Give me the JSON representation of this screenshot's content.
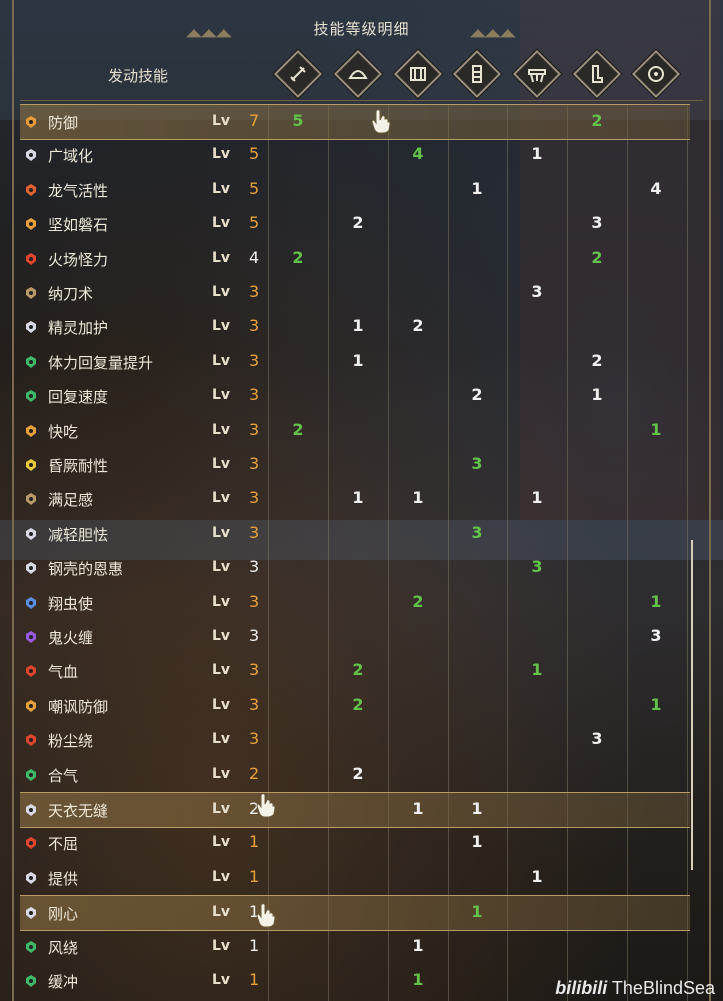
{
  "header": {
    "title": "技能等级明细",
    "active_skills_label": "发动技能"
  },
  "equipment_icons": [
    {
      "name": "weapon-icon"
    },
    {
      "name": "helmet-icon"
    },
    {
      "name": "chest-armor-icon"
    },
    {
      "name": "gauntlet-icon"
    },
    {
      "name": "waist-armor-icon"
    },
    {
      "name": "greaves-icon"
    },
    {
      "name": "talisman-icon"
    }
  ],
  "skills": [
    {
      "name": "防御",
      "lv_label": "Lv",
      "level": "7",
      "level_color": "o",
      "highlight": true,
      "icon_color": "#e89a3a",
      "cells": [
        [
          "5",
          "g"
        ],
        null,
        null,
        null,
        null,
        [
          "2",
          "g"
        ],
        null
      ]
    },
    {
      "name": "广域化",
      "lv_label": "Lv",
      "level": "5",
      "level_color": "o",
      "icon_color": "#d9d9e6",
      "cells": [
        null,
        null,
        [
          "4",
          "g"
        ],
        null,
        [
          "1",
          "w"
        ],
        null,
        null
      ]
    },
    {
      "name": "龙气活性",
      "lv_label": "Lv",
      "level": "5",
      "level_color": "o",
      "icon_color": "#e0622e",
      "cells": [
        null,
        null,
        null,
        [
          "1",
          "w"
        ],
        null,
        null,
        [
          "4",
          "w"
        ]
      ]
    },
    {
      "name": "坚如磐石",
      "lv_label": "Lv",
      "level": "5",
      "level_color": "o",
      "icon_color": "#e8a13a",
      "cells": [
        null,
        [
          "2",
          "w"
        ],
        null,
        null,
        null,
        [
          "3",
          "w"
        ],
        null
      ]
    },
    {
      "name": "火场怪力",
      "lv_label": "Lv",
      "level": "4",
      "level_color": "w",
      "icon_color": "#e0452e",
      "cells": [
        [
          "2",
          "g"
        ],
        null,
        null,
        null,
        null,
        [
          "2",
          "g"
        ],
        null
      ]
    },
    {
      "name": "纳刀术",
      "lv_label": "Lv",
      "level": "3",
      "level_color": "o",
      "icon_color": "#b89a6a",
      "cells": [
        null,
        null,
        null,
        null,
        [
          "3",
          "w"
        ],
        null,
        null
      ]
    },
    {
      "name": "精灵加护",
      "lv_label": "Lv",
      "level": "3",
      "level_color": "o",
      "icon_color": "#d9d9e6",
      "cells": [
        null,
        [
          "1",
          "w"
        ],
        [
          "2",
          "w"
        ],
        null,
        null,
        null,
        null
      ]
    },
    {
      "name": "体力回复量提升",
      "lv_label": "Lv",
      "level": "3",
      "level_color": "o",
      "icon_color": "#3fb86a",
      "cells": [
        null,
        [
          "1",
          "w"
        ],
        null,
        null,
        null,
        [
          "2",
          "w"
        ],
        null
      ]
    },
    {
      "name": "回复速度",
      "lv_label": "Lv",
      "level": "3",
      "level_color": "o",
      "icon_color": "#3fb86a",
      "cells": [
        null,
        null,
        null,
        [
          "2",
          "w"
        ],
        null,
        [
          "1",
          "w"
        ],
        null
      ]
    },
    {
      "name": "快吃",
      "lv_label": "Lv",
      "level": "3",
      "level_color": "o",
      "icon_color": "#e8a13a",
      "cells": [
        [
          "2",
          "g"
        ],
        null,
        null,
        null,
        null,
        null,
        [
          "1",
          "g"
        ]
      ]
    },
    {
      "name": "昏厥耐性",
      "lv_label": "Lv",
      "level": "3",
      "level_color": "o",
      "icon_color": "#e8c93a",
      "cells": [
        null,
        null,
        null,
        [
          "3",
          "g"
        ],
        null,
        null,
        null
      ]
    },
    {
      "name": "满足感",
      "lv_label": "Lv",
      "level": "3",
      "level_color": "o",
      "icon_color": "#b89a6a",
      "cells": [
        null,
        [
          "1",
          "w"
        ],
        [
          "1",
          "w"
        ],
        null,
        [
          "1",
          "w"
        ],
        null,
        null
      ]
    },
    {
      "name": "减轻胆怯",
      "lv_label": "Lv",
      "level": "3",
      "level_color": "o",
      "icon_color": "#d9d9e6",
      "cells": [
        null,
        null,
        null,
        [
          "3",
          "g"
        ],
        null,
        null,
        null
      ]
    },
    {
      "name": "钢壳的恩惠",
      "lv_label": "Lv",
      "level": "3",
      "level_color": "w",
      "icon_color": "#d9d9e6",
      "cells": [
        null,
        null,
        null,
        null,
        [
          "3",
          "g"
        ],
        null,
        null
      ]
    },
    {
      "name": "翔虫使",
      "lv_label": "Lv",
      "level": "3",
      "level_color": "o",
      "icon_color": "#5a8ee0",
      "cells": [
        null,
        null,
        [
          "2",
          "g"
        ],
        null,
        null,
        null,
        [
          "1",
          "g"
        ]
      ]
    },
    {
      "name": "鬼火缠",
      "lv_label": "Lv",
      "level": "3",
      "level_color": "w",
      "icon_color": "#9a5ae0",
      "cells": [
        null,
        null,
        null,
        null,
        null,
        null,
        [
          "3",
          "w"
        ]
      ]
    },
    {
      "name": "气血",
      "lv_label": "Lv",
      "level": "3",
      "level_color": "o",
      "icon_color": "#e0452e",
      "cells": [
        null,
        [
          "2",
          "g"
        ],
        null,
        null,
        [
          "1",
          "g"
        ],
        null,
        null
      ]
    },
    {
      "name": "嘲讽防御",
      "lv_label": "Lv",
      "level": "3",
      "level_color": "o",
      "icon_color": "#e8a13a",
      "cells": [
        null,
        [
          "2",
          "g"
        ],
        null,
        null,
        null,
        null,
        [
          "1",
          "g"
        ]
      ]
    },
    {
      "name": "粉尘绕",
      "lv_label": "Lv",
      "level": "3",
      "level_color": "o",
      "icon_color": "#e0452e",
      "cells": [
        null,
        null,
        null,
        null,
        null,
        [
          "3",
          "w"
        ],
        null
      ]
    },
    {
      "name": "合气",
      "lv_label": "Lv",
      "level": "2",
      "level_color": "o",
      "icon_color": "#3fb86a",
      "cells": [
        null,
        [
          "2",
          "w"
        ],
        null,
        null,
        null,
        null,
        null
      ]
    },
    {
      "name": "天衣无缝",
      "lv_label": "Lv",
      "level": "2",
      "level_color": "w",
      "highlight": true,
      "icon_color": "#d9d9e6",
      "cells": [
        null,
        null,
        [
          "1",
          "w"
        ],
        [
          "1",
          "w"
        ],
        null,
        null,
        null
      ]
    },
    {
      "name": "不屈",
      "lv_label": "Lv",
      "level": "1",
      "level_color": "o",
      "icon_color": "#e0452e",
      "cells": [
        null,
        null,
        null,
        [
          "1",
          "w"
        ],
        null,
        null,
        null
      ]
    },
    {
      "name": "提供",
      "lv_label": "Lv",
      "level": "1",
      "level_color": "o",
      "icon_color": "#d9d9e6",
      "cells": [
        null,
        null,
        null,
        null,
        [
          "1",
          "w"
        ],
        null,
        null
      ]
    },
    {
      "name": "刚心",
      "lv_label": "Lv",
      "level": "1",
      "level_color": "w",
      "highlight": true,
      "icon_color": "#d9d9e6",
      "cells": [
        null,
        null,
        null,
        [
          "1",
          "g"
        ],
        null,
        null,
        null
      ]
    },
    {
      "name": "风绕",
      "lv_label": "Lv",
      "level": "1",
      "level_color": "w",
      "icon_color": "#3fb86a",
      "cells": [
        null,
        null,
        [
          "1",
          "w"
        ],
        null,
        null,
        null,
        null
      ]
    },
    {
      "name": "缓冲",
      "lv_label": "Lv",
      "level": "1",
      "level_color": "o",
      "icon_color": "#3fb86a",
      "cells": [
        null,
        null,
        [
          "1",
          "g"
        ],
        null,
        null,
        null,
        null
      ]
    }
  ],
  "watermark": {
    "logo": "bilibili",
    "text": "TheBlindSea"
  }
}
